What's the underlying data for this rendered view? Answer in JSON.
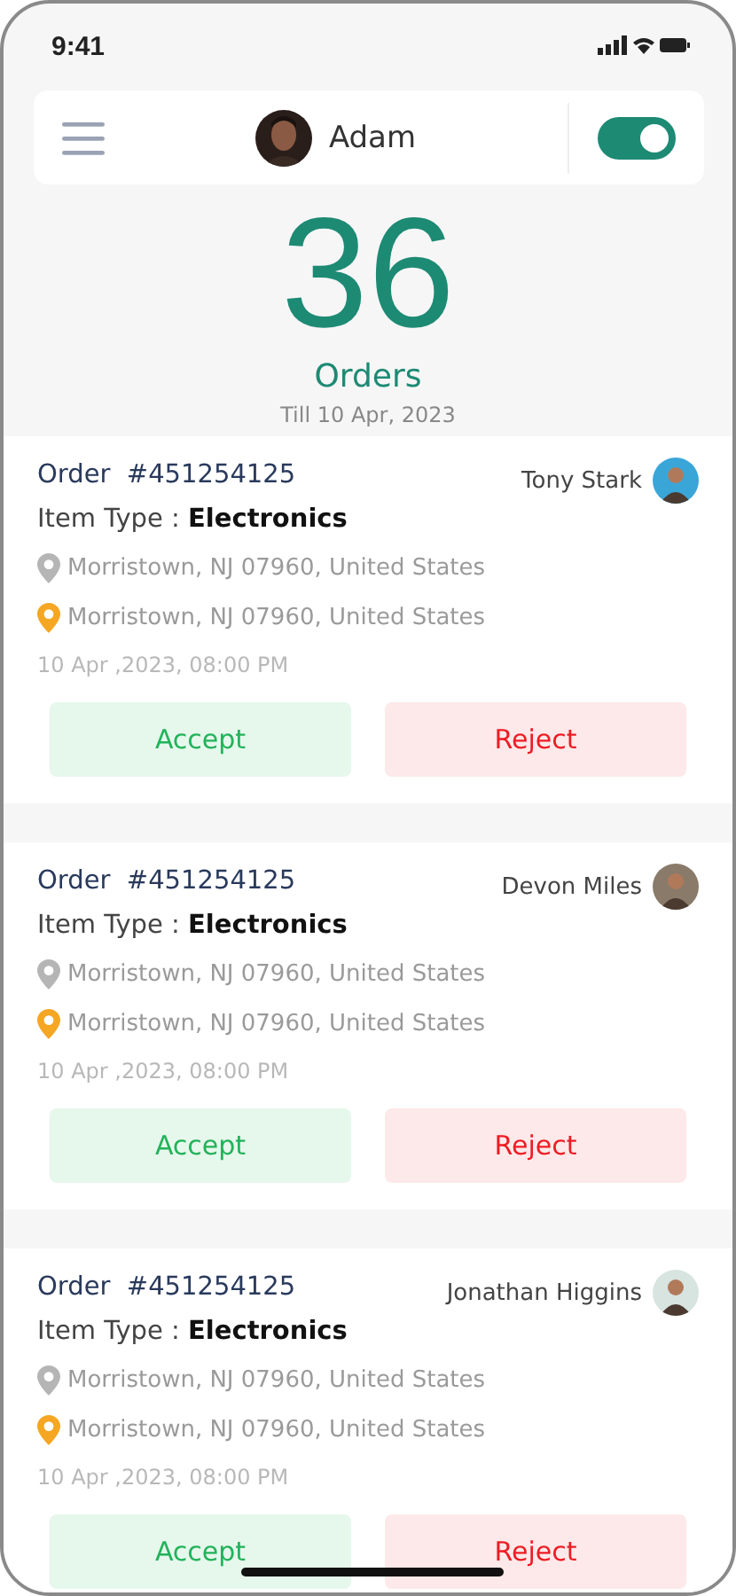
{
  "status_bar": {
    "time": "9:41"
  },
  "header": {
    "user_name": "Adam",
    "toggle": {
      "on": true
    }
  },
  "summary": {
    "count": "36",
    "label": "Orders",
    "period": "Till 10 Apr, 2023"
  },
  "orders": [
    {
      "order_label": "Order",
      "order_number": "#451254125",
      "customer": "Tony Stark",
      "item_type_label": "Item Type :",
      "item_type": "Electronics",
      "addresses": [
        {
          "kind": "pickup",
          "text": "Morristown, NJ 07960, United States"
        },
        {
          "kind": "dropoff",
          "text": "Morristown, NJ 07960, United States"
        }
      ],
      "date": "10 Apr ,2023, 08:00 PM",
      "actions": [
        {
          "kind": "accept",
          "label": "Accept"
        },
        {
          "kind": "reject",
          "label": "Reject"
        }
      ]
    },
    {
      "order_label": "Order",
      "order_number": "#451254125",
      "customer": "Devon Miles",
      "item_type_label": "Item Type :",
      "item_type": "Electronics",
      "addresses": [
        {
          "kind": "pickup",
          "text": "Morristown, NJ 07960, United States"
        },
        {
          "kind": "dropoff",
          "text": "Morristown, NJ 07960, United States"
        }
      ],
      "date": "10 Apr ,2023, 08:00 PM",
      "actions": [
        {
          "kind": "accept",
          "label": "Accept"
        },
        {
          "kind": "reject",
          "label": "Reject"
        }
      ]
    },
    {
      "order_label": "Order",
      "order_number": "#451254125",
      "customer": "Jonathan Higgins",
      "item_type_label": "Item Type :",
      "item_type": "Electronics",
      "addresses": [
        {
          "kind": "pickup",
          "text": "Morristown, NJ 07960, United States"
        },
        {
          "kind": "dropoff",
          "text": "Morristown, NJ 07960, United States"
        }
      ],
      "date": "10 Apr ,2023, 08:00 PM",
      "actions": [
        {
          "kind": "accept",
          "label": "Accept"
        },
        {
          "kind": "reject",
          "label": "Reject"
        }
      ]
    }
  ]
}
